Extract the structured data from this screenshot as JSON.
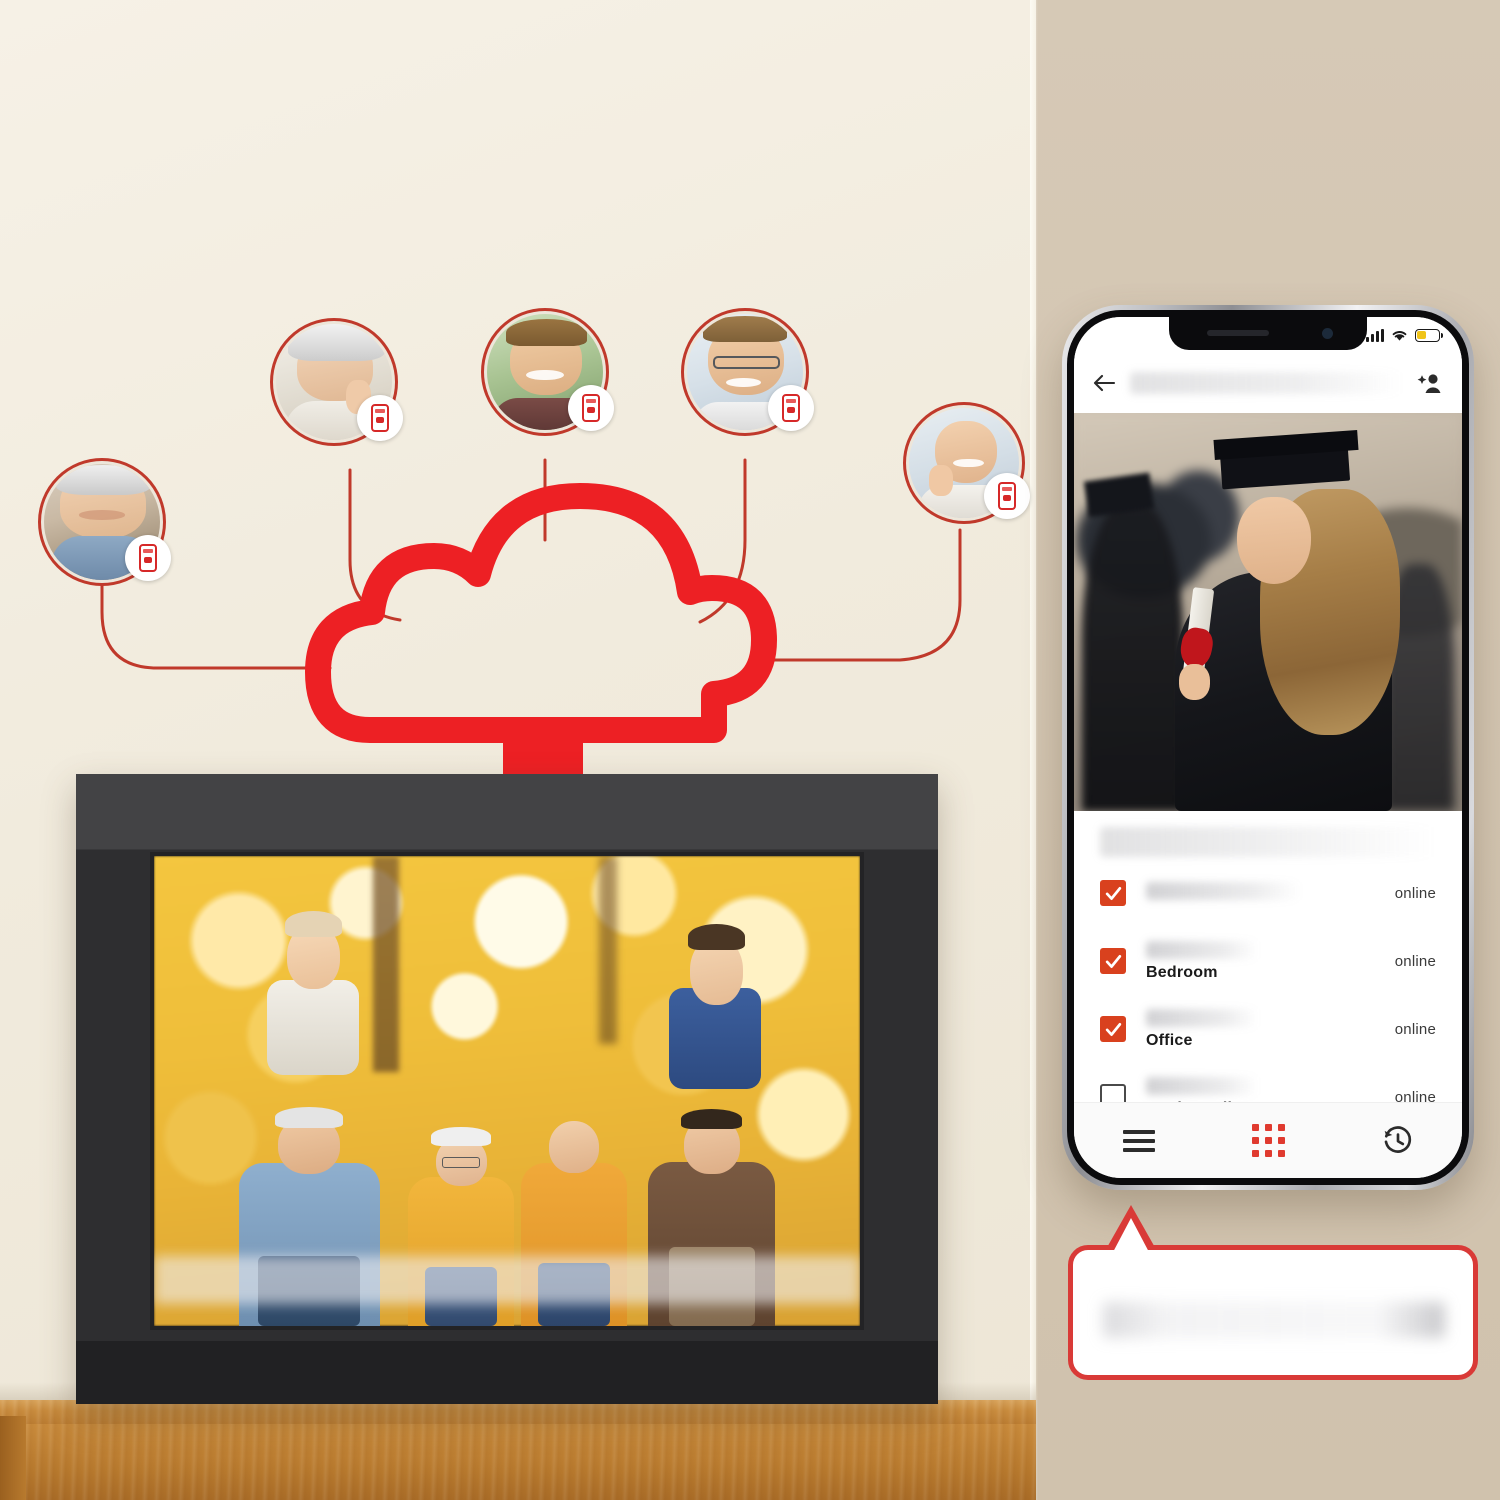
{
  "scene": {
    "left_panel_bg": "#F1EBDD",
    "right_panel_bg": "#D3C5B1",
    "accent_red": "#ED2024",
    "checkbox_red": "#D9411E"
  },
  "cloud_diagram": {
    "cloud_icon_name": "cloud-outline",
    "connector_count": 5,
    "avatars": [
      {
        "id": "avatar-1",
        "person": "older-man",
        "badge_icon": "phone-app-icon"
      },
      {
        "id": "avatar-2",
        "person": "older-woman",
        "badge_icon": "phone-app-icon"
      },
      {
        "id": "avatar-3",
        "person": "young-man",
        "badge_icon": "phone-app-icon"
      },
      {
        "id": "avatar-4",
        "person": "man-with-glasses",
        "badge_icon": "phone-app-icon"
      },
      {
        "id": "avatar-5",
        "person": "young-woman",
        "badge_icon": "phone-app-icon"
      }
    ]
  },
  "photo_frame": {
    "device_name": "digital-photo-frame",
    "displayed_photo": "family-in-autumn-park"
  },
  "phone": {
    "status_bar": {
      "signal_icon": "cellular-signal-icon",
      "wifi_icon": "wifi-icon",
      "battery_icon": "battery-icon"
    },
    "appbar": {
      "back_icon": "back-arrow-icon",
      "title": "",
      "add_icon": "add-person-icon"
    },
    "hero_photo": "graduation-portrait",
    "device_list": {
      "header": "",
      "rows": [
        {
          "checked": true,
          "redacted_line": "",
          "name": "",
          "status": "online"
        },
        {
          "checked": true,
          "redacted_line": "",
          "name": "Bedroom",
          "status": "online"
        },
        {
          "checked": true,
          "redacted_line": "",
          "name": "Office",
          "status": "online"
        },
        {
          "checked": false,
          "redacted_line": "",
          "name": "Work Studio",
          "status": "online"
        }
      ]
    },
    "bottom_nav": [
      {
        "id": "nav-menu",
        "icon": "hamburger-menu-icon",
        "active": false
      },
      {
        "id": "nav-grid",
        "icon": "grid-apps-icon",
        "active": true
      },
      {
        "id": "nav-history",
        "icon": "history-clock-icon",
        "active": false
      }
    ]
  },
  "callout": {
    "text": ""
  }
}
